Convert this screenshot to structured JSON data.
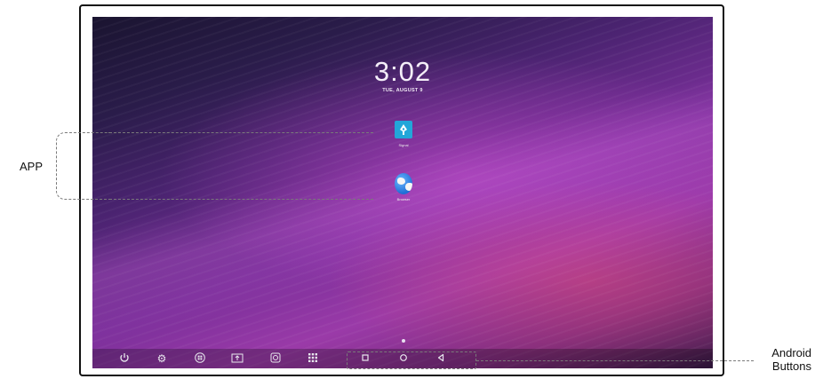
{
  "lock_screen": {
    "time": "3:02",
    "date": "TUE, AUGUST 9"
  },
  "apps": [
    {
      "label": "Signal",
      "icon": "pen-nib-icon"
    },
    {
      "label": "Browser",
      "icon": "globe-icon"
    }
  ],
  "taskbar": {
    "icons": [
      "power-icon",
      "gear-icon",
      "windows-icon",
      "screen-share-icon",
      "camera-icon",
      "app-grid-icon"
    ]
  },
  "nav_buttons": [
    "recents-button",
    "home-button",
    "back-button"
  ],
  "annotations": {
    "app_label": "APP",
    "android_buttons_label_line1": "Android",
    "android_buttons_label_line2": "Buttons"
  },
  "colors": {
    "wallpaper_dark": "#1a1430",
    "wallpaper_purple": "#9a3aa8",
    "app_tile": "#23a6d9",
    "annotation_dash": "#7a7a7a"
  }
}
